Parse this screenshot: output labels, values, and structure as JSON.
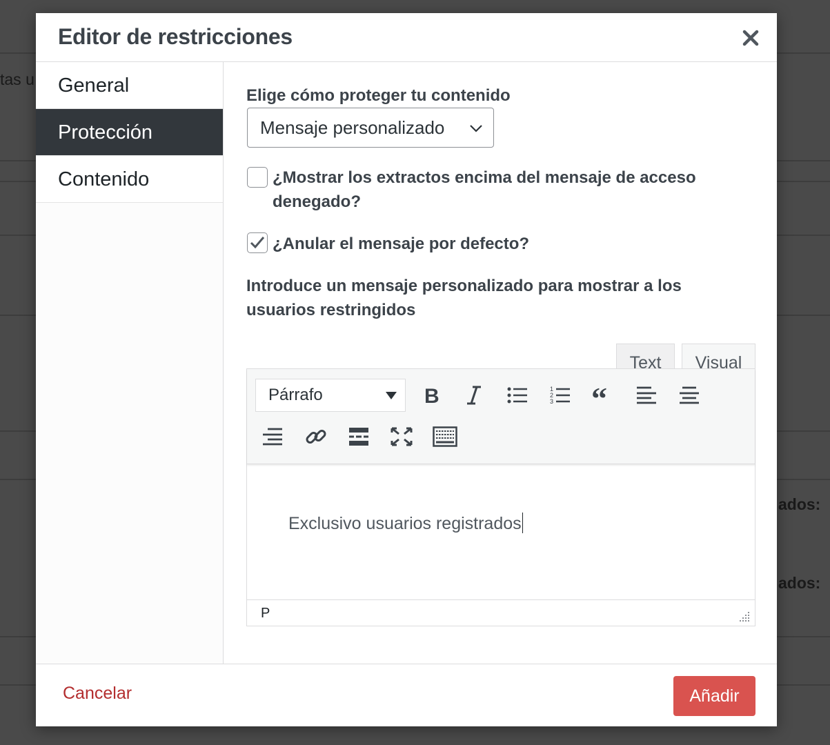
{
  "background": {
    "fragment_1": "tas u",
    "fragment_2": "ados:",
    "fragment_3": "ados:"
  },
  "modal": {
    "title": "Editor de restricciones",
    "close_icon": "close-icon"
  },
  "sidebar": {
    "items": [
      {
        "label": "General",
        "active": false
      },
      {
        "label": "Protección",
        "active": true
      },
      {
        "label": "Contenido",
        "active": false
      }
    ]
  },
  "protection": {
    "method_label": "Elige cómo proteger tu contenido",
    "method_selected": "Mensaje personalizado",
    "show_excerpts": {
      "line1": "¿Mostrar los extractos encima del mensaje de acceso",
      "line2": "denegado?",
      "checked": false
    },
    "override_default": {
      "label": "¿Anular el mensaje por defecto?",
      "checked": true
    },
    "custom_message_label": {
      "line1": "Introduce un mensaje personalizado para mostrar a los",
      "line2": "usuarios restringidos"
    }
  },
  "editor": {
    "tabs": [
      {
        "label": "Text",
        "active": false
      },
      {
        "label": "Visual",
        "active": true
      }
    ],
    "format_selected": "Párrafo",
    "toolbar_icons": [
      "bold-icon",
      "italic-icon",
      "bullet-list-icon",
      "numbered-list-icon",
      "blockquote-icon",
      "align-left-icon",
      "align-center-icon",
      "align-right-icon",
      "link-icon",
      "read-more-icon",
      "fullscreen-icon",
      "toolbar-toggle-icon"
    ],
    "content": "Exclusivo usuarios registrados",
    "status_path": "P"
  },
  "footer": {
    "cancel_label": "Cancelar",
    "add_label": "Añadir"
  },
  "colors": {
    "accent_danger": "#d9534f",
    "cancel_text": "#b32d2e",
    "sidebar_active": "#32373c"
  }
}
